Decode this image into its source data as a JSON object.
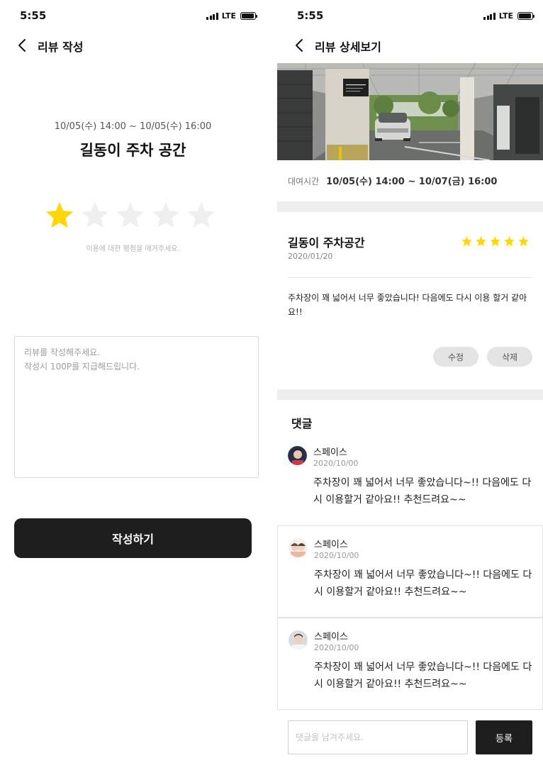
{
  "status_bar": {
    "time": "5:55",
    "network": "LTE"
  },
  "write_screen": {
    "title": "리뷰 작성",
    "rental_period": "10/05(수) 14:00 ~ 10/05(수) 16:00",
    "place_name": "길동이 주차 공간",
    "rating": {
      "value": 1,
      "max": 5,
      "hint": "이용에 대한 평점을 매겨주세요."
    },
    "review_placeholder": "리뷰를 작성해주세요.\n작성시 100P를 지급해드립니다.",
    "submit_label": "작성하기"
  },
  "detail_screen": {
    "title": "리뷰 상세보기",
    "rental_label": "대여시간",
    "rental_period": "10/05(수) 14:00 ~ 10/07(금) 16:00",
    "review": {
      "place_name": "길동이 주차공간",
      "date": "2020/01/20",
      "rating": 5,
      "text": "주차장이 꽤 넓어서 너무 좋았습니다! 다음에도 다시 이용 할거 같아요!!"
    },
    "edit_label": "수정",
    "delete_label": "삭제",
    "comments_title": "댓글",
    "comments": [
      {
        "author": "스페이스",
        "date": "2020/10/00",
        "text": "주차장이 꽤 넓어서 너무 좋았습니다~!! 다음에도 다시 이용할거 같아요!! 추천드려요~~"
      },
      {
        "author": "스페이스",
        "date": "2020/10/00",
        "text": "주차장이 꽤 넓어서 너무 좋았습니다~!! 다음에도 다시 이용할거 같아요!! 추천드려요~~"
      },
      {
        "author": "스페이스",
        "date": "2020/10/00",
        "text": "주차장이 꽤 넓어서 너무 좋았습니다~!! 다음에도 다시 이용할거 같아요!! 추천드려요~~"
      }
    ],
    "comment_placeholder": "댓글을 남겨주세요.",
    "register_label": "등록"
  },
  "colors": {
    "star_active": "#FFD60A",
    "star_inactive": "#EFEFEF",
    "button_dark": "#1E1E1E",
    "pill_gray": "#E4E4E4"
  }
}
